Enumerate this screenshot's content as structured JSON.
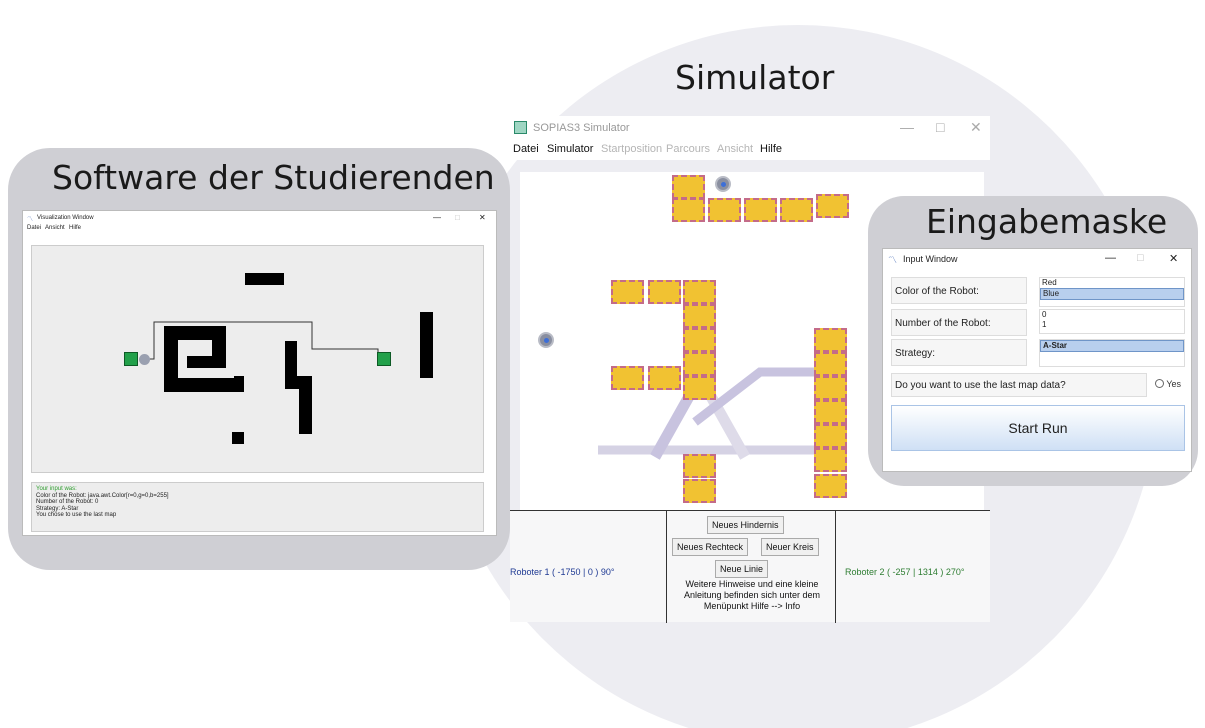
{
  "labels": {
    "simulator": "Simulator",
    "software": "Software der Studierenden",
    "eingabemaske": "Eingabemaske"
  },
  "simulator_window": {
    "title": "SOPIAS3 Simulator",
    "menu": [
      "Datei",
      "Simulator",
      "Startposition",
      "Parcours",
      "Ansicht",
      "Hilfe"
    ],
    "buttons": {
      "new_obstacle": "Neues Hindernis",
      "new_rectangle": "Neues Rechteck",
      "new_circle": "Neuer Kreis",
      "new_line": "Neue Linie"
    },
    "hint": "Weitere Hinweise und eine kleine Anleitung befinden sich unter dem Menüpunkt Hilfe --> Info",
    "robot1_status": "Roboter 1 ( -1750 | 0 ) 90°",
    "robot2_status": "Roboter 2 ( -257 | 1314 ) 270°",
    "colors": {
      "obstacle_fill": "#f1c232",
      "obstacle_border": "#c46b88",
      "robot1_text": "#1f3a93",
      "robot2_text": "#2e7d32"
    }
  },
  "viz_window": {
    "title": "Visualization Window",
    "menu": [
      "Datei",
      "Ansicht",
      "Hilfe"
    ],
    "output": {
      "heading": "Your input was:",
      "line1": "Color of the Robot: java.awt.Color[r=0,g=0,b=255]",
      "line2": "Number of the Robot: 0",
      "line3": "Strategy: A-Star",
      "line4": "You chose to use the last map"
    }
  },
  "input_window": {
    "title": "Input Window",
    "color_label": "Color of the Robot:",
    "color_options": [
      "Red",
      "Blue"
    ],
    "color_selected": "Blue",
    "number_label": "Number of the Robot:",
    "number_options": [
      "0",
      "1"
    ],
    "strategy_label": "Strategy:",
    "strategy_selected": "A-Star",
    "last_map_question": "Do you want to use the last map data?",
    "yes_label": "Yes",
    "start_button": "Start Run"
  },
  "window_controls": {
    "minimize": "—",
    "maximize": "□",
    "close": "✕"
  }
}
